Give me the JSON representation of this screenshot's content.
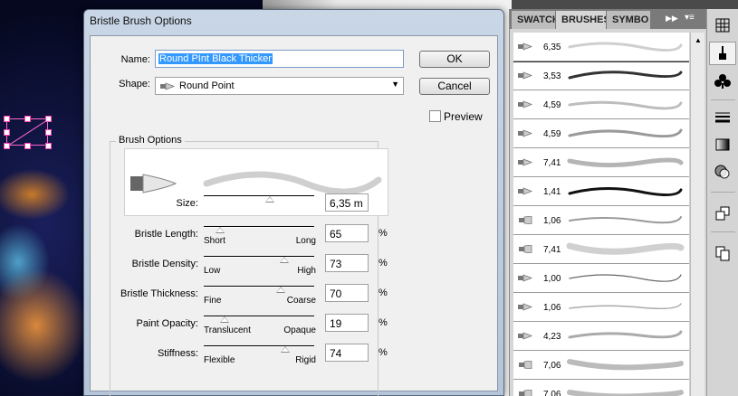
{
  "dialog": {
    "title": "Bristle Brush Options",
    "name_label": "Name:",
    "name_value": "Round PInt Black Thicker",
    "shape_label": "Shape:",
    "shape_value": "Round Point",
    "ok_label": "OK",
    "cancel_label": "Cancel",
    "preview_label": "Preview",
    "group_title": "Brush Options",
    "sliders": [
      {
        "label": "Size:",
        "value": "6,35 m",
        "min_label": "",
        "max_label": "",
        "unit": "",
        "level": 0.6
      },
      {
        "label": "Bristle Length:",
        "value": "65",
        "min_label": "Short",
        "max_label": "Long",
        "unit": "%",
        "level": 0.15
      },
      {
        "label": "Bristle Density:",
        "value": "73",
        "min_label": "Low",
        "max_label": "High",
        "unit": "%",
        "level": 0.73
      },
      {
        "label": "Bristle Thickness:",
        "value": "70",
        "min_label": "Fine",
        "max_label": "Coarse",
        "unit": "%",
        "level": 0.7
      },
      {
        "label": "Paint Opacity:",
        "value": "19",
        "min_label": "Translucent",
        "max_label": "Opaque",
        "unit": "%",
        "level": 0.19
      },
      {
        "label": "Stiffness:",
        "value": "74",
        "min_label": "Flexible",
        "max_label": "Rigid",
        "unit": "%",
        "level": 0.74
      }
    ]
  },
  "panel": {
    "tabs": [
      "SWATCH",
      "BRUSHES",
      "SYMBO"
    ],
    "active_tab": "BRUSHES",
    "brushes": [
      {
        "value": "6,35",
        "shape": "round"
      },
      {
        "value": "3,53",
        "shape": "round"
      },
      {
        "value": "4,59",
        "shape": "round"
      },
      {
        "value": "4,59",
        "shape": "round"
      },
      {
        "value": "7,41",
        "shape": "round"
      },
      {
        "value": "1,41",
        "shape": "round"
      },
      {
        "value": "1,06",
        "shape": "fan"
      },
      {
        "value": "7,41",
        "shape": "fan"
      },
      {
        "value": "1,00",
        "shape": "round"
      },
      {
        "value": "1,06",
        "shape": "round"
      },
      {
        "value": "4,23",
        "shape": "round"
      },
      {
        "value": "7,06",
        "shape": "fan"
      },
      {
        "value": "7,06",
        "shape": "fan"
      }
    ]
  },
  "dock": {
    "icons": [
      "swatches-icon",
      "brushes-icon",
      "symbols-icon",
      "stroke-icon",
      "gradient-icon",
      "transparency-icon",
      "align-icon",
      "layers-icon"
    ]
  }
}
